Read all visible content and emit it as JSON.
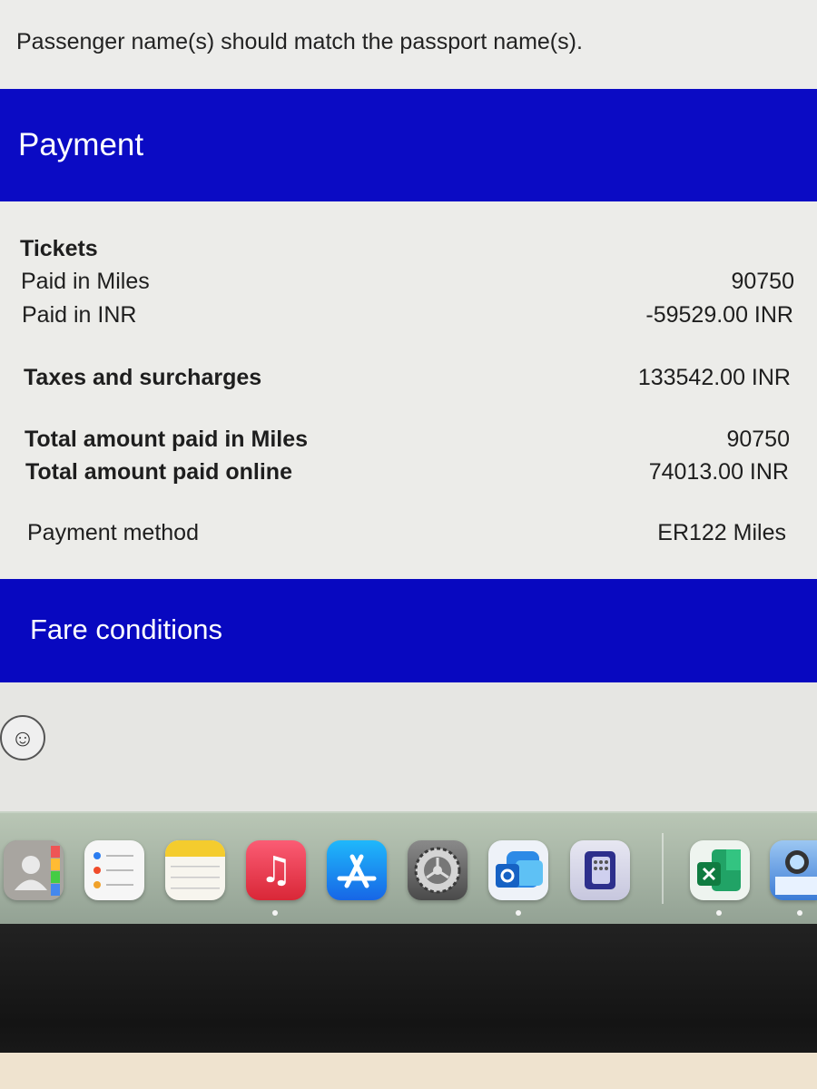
{
  "notice": {
    "text": "Passenger name(s) should match the passport name(s)."
  },
  "payment": {
    "title": "Payment",
    "tickets_heading": "Tickets",
    "rows": [
      {
        "label": "Paid in Miles",
        "value": "90750"
      },
      {
        "label": "Paid in INR",
        "value": "-59529.00 INR"
      },
      {
        "label": "Taxes and surcharges",
        "value": "133542.00 INR"
      },
      {
        "label": "Total amount paid in Miles",
        "value": "90750"
      },
      {
        "label": "Total amount paid online",
        "value": "74013.00 INR"
      },
      {
        "label": "Payment method",
        "value": "ER122 Miles"
      }
    ]
  },
  "fare_conditions": {
    "title": "Fare conditions"
  },
  "dock": {
    "apps": [
      {
        "name": "contacts-icon"
      },
      {
        "name": "reminders-icon"
      },
      {
        "name": "notes-icon"
      },
      {
        "name": "music-icon"
      },
      {
        "name": "app-store-icon"
      },
      {
        "name": "system-settings-icon"
      },
      {
        "name": "outlook-icon"
      },
      {
        "name": "remote-desktop-icon"
      },
      {
        "name": "excel-icon"
      },
      {
        "name": "preview-icon"
      }
    ]
  },
  "colors": {
    "band_blue": "#0b0bc4",
    "page_background": "#ecece9"
  }
}
